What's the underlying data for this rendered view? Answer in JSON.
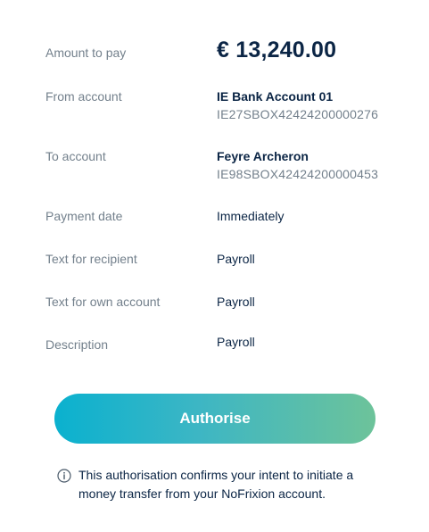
{
  "details": {
    "amount": {
      "label": "Amount to pay",
      "value": "€ 13,240.00"
    },
    "from_account": {
      "label": "From account",
      "name": "IE Bank Account 01",
      "iban": "IE27SBOX42424200000276"
    },
    "to_account": {
      "label": "To account",
      "name": "Feyre Archeron",
      "iban": "IE98SBOX42424200000453"
    },
    "payment_date": {
      "label": "Payment date",
      "value": "Immediately"
    },
    "text_for_recipient": {
      "label": "Text for recipient",
      "value": "Payroll"
    },
    "text_for_own_account": {
      "label": "Text for own account",
      "value": "Payroll"
    },
    "description": {
      "label": "Description",
      "value": "Payroll"
    }
  },
  "actions": {
    "authorise_label": "Authorise"
  },
  "info": {
    "icon": "info-circle-icon",
    "text": "This authorisation confirms your intent to initiate a money transfer from your NoFrixion account."
  },
  "colors": {
    "text_primary": "#0b2545",
    "text_secondary": "#73808c",
    "button_gradient_start": "#0ab1cf",
    "button_gradient_end": "#6dc39a"
  }
}
